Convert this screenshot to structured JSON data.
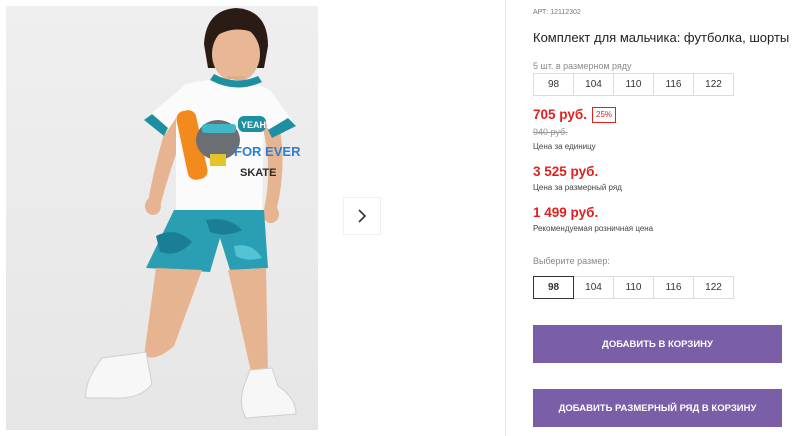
{
  "product": {
    "article": "АРТ: 12112302",
    "title": "Комплект для мальчика: футболка, шорты"
  },
  "size_row_info": {
    "hint": "5 шт. в размерном ряду",
    "sizes": [
      "98",
      "104",
      "110",
      "116",
      "122"
    ]
  },
  "pricing": {
    "price": "705 руб.",
    "discount": "25%",
    "old_price": "940 руб.",
    "price_caption": "Цена за единицу",
    "row_price": "3 525 руб.",
    "row_caption": "Цена за размерный ряд",
    "retail_price": "1 499 руб.",
    "retail_caption": "Рекомендуемая розничная цена"
  },
  "size_picker": {
    "label": "Выберите размер:",
    "sizes": [
      "98",
      "104",
      "110",
      "116",
      "122"
    ],
    "selected": "98"
  },
  "actions": {
    "add_to_cart": "ДОБАВИТЬ В КОРЗИНУ",
    "add_row_to_cart": "ДОБАВИТЬ РАЗМЕРНЫЙ РЯД В КОРЗИНУ"
  },
  "print": {
    "bubble": "YEAH!",
    "for_ever": "FOR EVER",
    "skate": "SKATE"
  },
  "colors": {
    "accent": "#7a5fa8",
    "price": "#e11f1f"
  },
  "icons": {
    "next": "chevron-right-icon"
  }
}
